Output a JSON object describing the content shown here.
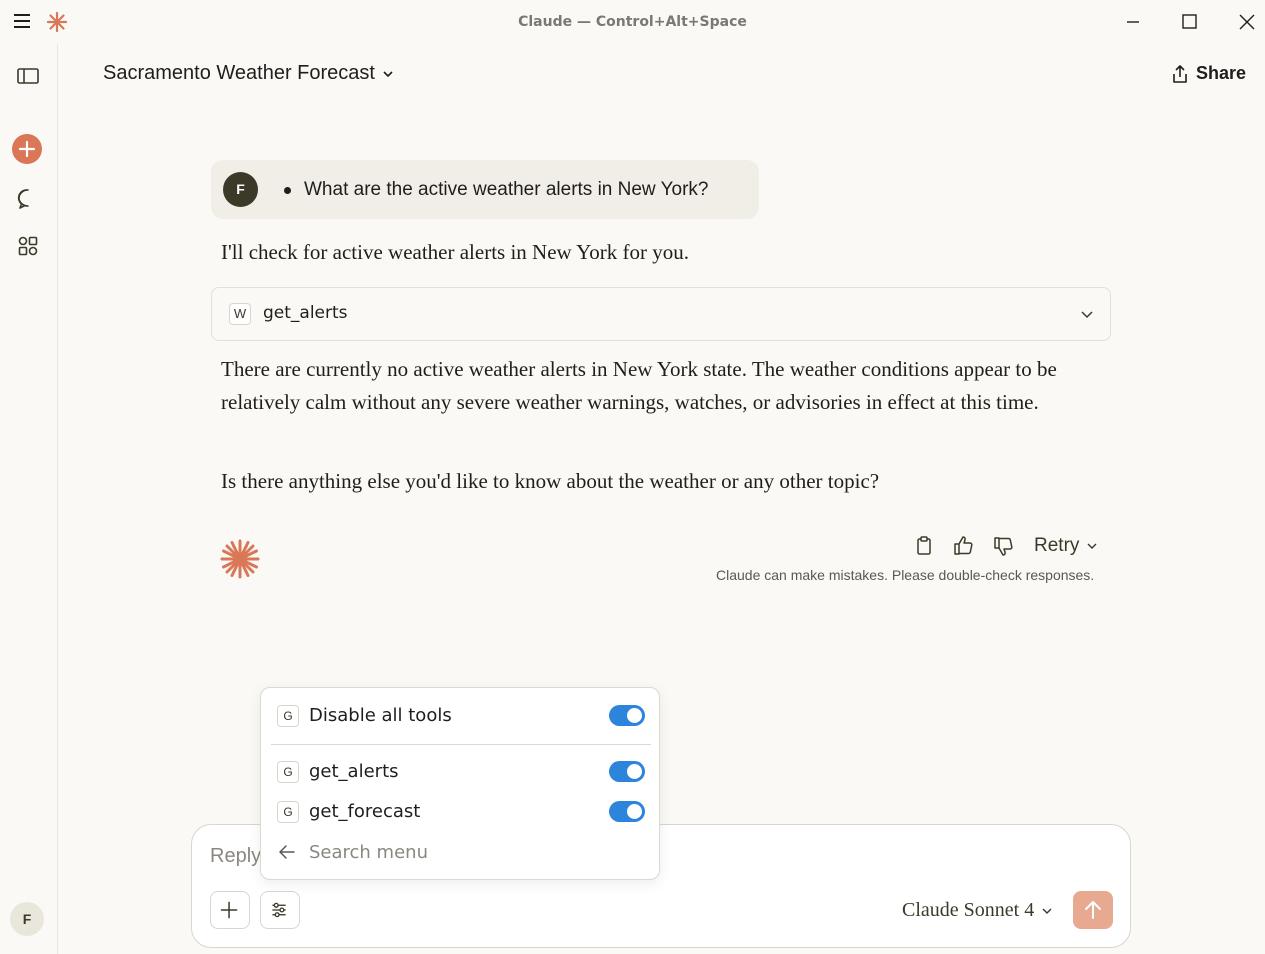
{
  "window": {
    "title": "Claude — Control+Alt+Space",
    "icons": [
      "hamburger-menu-icon",
      "claude-logo-icon",
      "minimize-icon",
      "maximize-icon",
      "close-icon"
    ]
  },
  "sidebar": {
    "icons": [
      "sidebar-toggle-icon",
      "new-chat-icon",
      "chats-icon",
      "projects-icon"
    ],
    "user_initial": "F"
  },
  "header": {
    "conversation_title": "Sacramento Weather Forecast",
    "share_label": "Share"
  },
  "conversation": {
    "user_initial": "F",
    "user_message": "What are the active weather alerts in New York?",
    "assistant_intro": "I'll check for active weather alerts in New York for you.",
    "tool_call": {
      "badge": "W",
      "name": "get_alerts"
    },
    "assistant_answer": "There are currently no active weather alerts in New York state. The weather conditions appear to be relatively calm without any severe weather warnings, watches, or advisories in effect at this time.",
    "assistant_question": "Is there anything else you'd like to know about the weather or any other topic?",
    "retry_label": "Retry",
    "disclaimer": "Claude can make mistakes. Please double-check responses."
  },
  "composer": {
    "placeholder": "Reply to Claude...",
    "model": "Claude Sonnet 4"
  },
  "tools_menu": {
    "items": [
      {
        "badge": "G",
        "label": "Disable all tools",
        "enabled": true
      },
      {
        "badge": "G",
        "label": "get_alerts",
        "enabled": true
      },
      {
        "badge": "G",
        "label": "get_forecast",
        "enabled": true
      }
    ],
    "search_placeholder": "Search menu"
  },
  "colors": {
    "accent": "#d97757",
    "toggle_on": "#2c84db",
    "background": "#faf9f5",
    "send_button": "#e8a991"
  }
}
